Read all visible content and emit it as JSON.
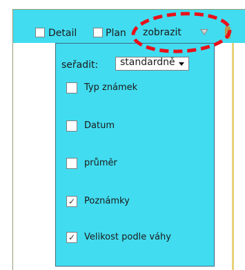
{
  "toolbar": {
    "detail_label": "Detail",
    "plan_label": "Plan",
    "show_label": "zobrazit",
    "show_dropdown_icon": "triangle-down-icon",
    "extra_icon": "toolbar-extra-icon"
  },
  "dropdown": {
    "sort": {
      "label": "seřadit:",
      "value": "standardně"
    },
    "options": [
      {
        "label": "Typ známek",
        "checked": false
      },
      {
        "label": "Datum",
        "checked": false
      },
      {
        "label": "průměr",
        "checked": false
      },
      {
        "label": "Poznámky",
        "checked": true
      },
      {
        "label": "Velikost podle váhy",
        "checked": true
      }
    ]
  },
  "checkmark_glyph": "✓",
  "colors": {
    "panel_bg": "#42dcf0",
    "annotation_red": "#e8101a",
    "accent_border": "#e8d27a"
  }
}
